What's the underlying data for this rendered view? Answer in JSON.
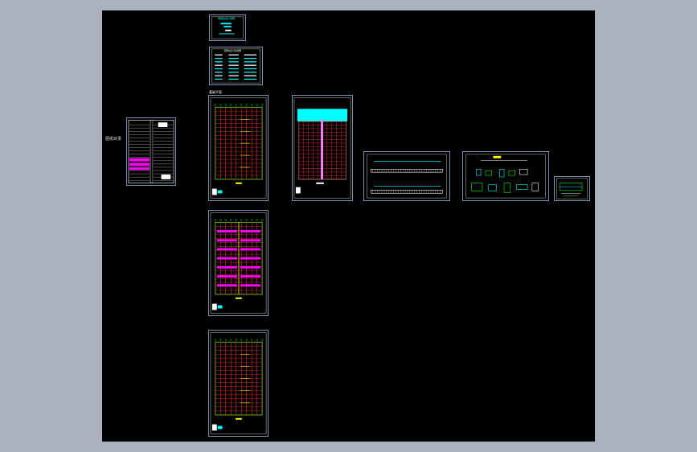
{
  "viewport": {
    "background_color": "#abb2bd",
    "model_space_color": "#000000",
    "sheet_border_color": "#7d8fb5"
  },
  "index_sheet": {
    "side_label": "图纸目录",
    "accent_colors": [
      "#ff00ff",
      "#ffffff"
    ]
  },
  "cover_sheet": {
    "title": "钢结构设计说明",
    "accent_color": "#00ffff"
  },
  "notes_sheet": {
    "title": "结构设计总说明",
    "accent_color": "#00ffff"
  },
  "plan_sheets": [
    {
      "id": "plan-1",
      "tag": "基础平面",
      "grid_color": "#00ff00",
      "member_color": "#ff3030",
      "highlight_color": "#ffff00"
    },
    {
      "id": "plan-2",
      "tag": "",
      "grid_color": "#00ff00",
      "member_color": "#ff3030",
      "highlight_color": "#ff00ff"
    },
    {
      "id": "plan-3",
      "tag": "",
      "grid_color": "#00ff00",
      "member_color": "#ff3030",
      "highlight_color": "#ffff00"
    }
  ],
  "roof_sheet": {
    "band_color": "#00ffff",
    "member_color": "#ff3030"
  },
  "elevation_sheet": {
    "line_color": "#00ffff"
  },
  "detail_sheet": {
    "line_color": "#00ff00"
  },
  "small_detail_sheet": {
    "line_color": "#00ff00"
  }
}
